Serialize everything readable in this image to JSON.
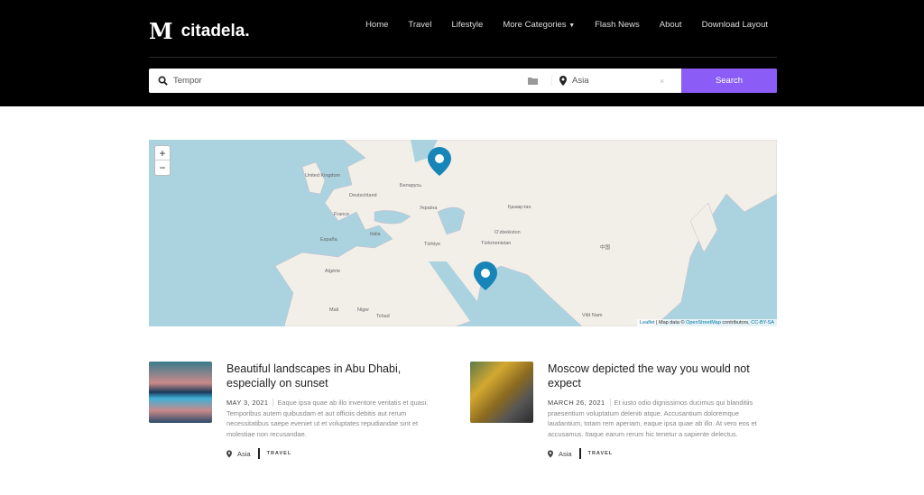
{
  "header": {
    "logo_mark": "M",
    "logo_text": "citadela.",
    "nav": [
      "Home",
      "Travel",
      "Lifestyle",
      "More Categories",
      "Flash News",
      "About",
      "Download Layout"
    ]
  },
  "search": {
    "query": "Tempor",
    "location": "Asia",
    "clear": "×",
    "button": "Search"
  },
  "map": {
    "zoom_in": "+",
    "zoom_out": "−",
    "labels": [
      "United Kingdom",
      "Deutschland",
      "France",
      "España",
      "Italia",
      "Беларусь",
      "Україна",
      "Türkiye",
      "Қазақстан",
      "Oʻzbekiston",
      "Türkmenistan",
      "中国",
      "Algérie",
      "Mali",
      "Niger",
      "Tchad",
      "Việt Nam"
    ],
    "attribution": {
      "leaflet": "Leaflet",
      "mid": " | Map data © ",
      "osm": "OpenStreetMap",
      "contrib": " contributors, ",
      "license": "CC-BY-SA"
    },
    "pin_color": "#1785b8"
  },
  "posts": [
    {
      "title": "Beautiful landscapes in Abu Dhabi, especially on sunset",
      "date": "MAY 3, 2021",
      "excerpt": "Eaque ipsa quae ab illo inventore veritatis et quasi. Temporibus autem quibusdam et aut officiis debitis aut rerum necessitatibus saepe eveniet ut et voluptates repudiandae sint et molestiae non recusandae.",
      "location": "Asia",
      "category": "TRAVEL"
    },
    {
      "title": "Moscow depicted the way you would not expect",
      "date": "MARCH 26, 2021",
      "excerpt": "Et iusto odio dignissimos ducimus qui blanditiis praesentium voluptatum deleniti atque. Accusantium doloremque laudantium, totam rem aperiam, eaque ipsa quae ab illo. At vero eos et accusamus. Itaque earum rerum hic tenetur a sapiente delectus.",
      "location": "Asia",
      "category": "TRAVEL"
    }
  ],
  "colors": {
    "accent": "#8b5cf6",
    "header_bg": "#000000"
  }
}
